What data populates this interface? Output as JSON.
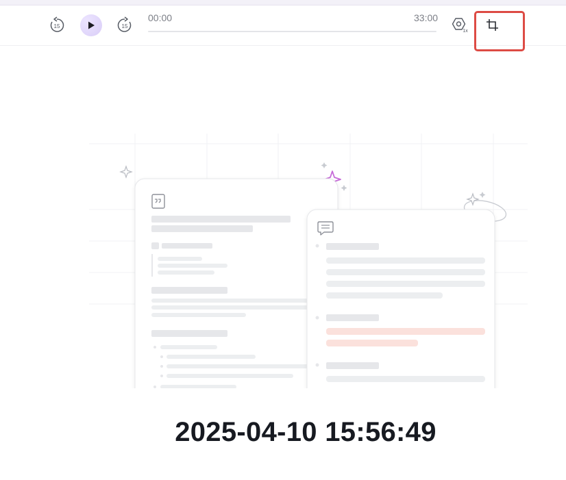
{
  "player": {
    "current_time": "00:00",
    "duration": "33:00",
    "progress_fraction": 0,
    "rewind_seconds": "15",
    "forward_seconds": "15",
    "speed": "1x",
    "icons": [
      "rewind-15-icon",
      "play-icon",
      "forward-15-icon",
      "playback-speed-icon",
      "crop-icon"
    ]
  },
  "colors": {
    "play_button_bg": "#e2d8fb",
    "highlight_box": "#dd4b44",
    "skeleton": "#e6e7ea",
    "skeleton_highlight": "#fbe1dc",
    "sparkle": "#c66bd8"
  },
  "illustration": {
    "icons": [
      "quote-card-icon",
      "chat-bubble-icon",
      "sparkle-icon"
    ]
  },
  "timestamp": "2025-04-10 15:56:49"
}
